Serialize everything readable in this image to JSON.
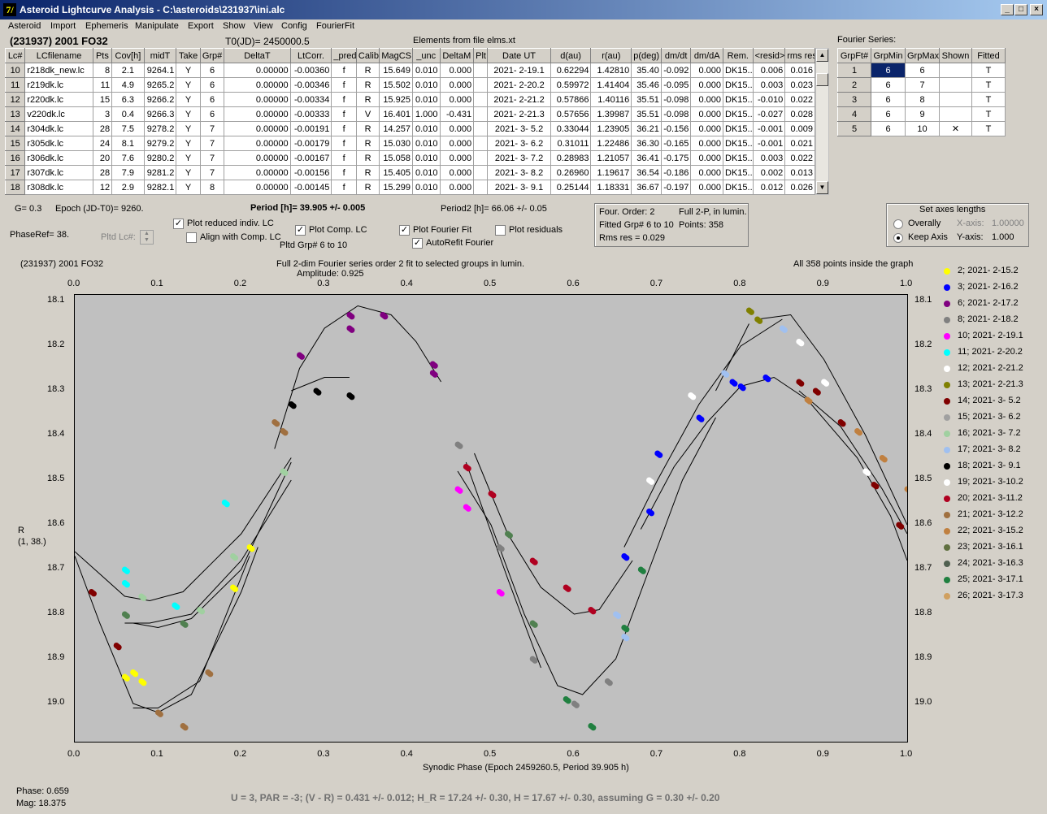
{
  "window": {
    "title": "Asteroid Lightcurve Analysis - C:\\asteroids\\231937\\ini.alc",
    "icon_label": "7/"
  },
  "menu": [
    "Asteroid",
    "Import",
    "Ephemeris",
    "Manipulate",
    "Export",
    "Show",
    "View",
    "Config",
    "FourierFit"
  ],
  "header": {
    "object": "(231937) 2001 FO32",
    "t0": "T0(JD)= 2450000.5",
    "elements": "Elements from file elms.xt",
    "fourier_series_label": "Fourier Series:"
  },
  "table": {
    "columns": [
      "Lc#",
      "LCfilename",
      "Pts",
      "Cov[h]",
      "midT",
      "Take",
      "Grp#",
      "DeltaT",
      "LtCorr.",
      "_pred.",
      "Calib.",
      "MagCS",
      "_unc",
      "DeltaM",
      "Plt",
      "Date UT",
      "d(au)",
      "r(au)",
      "p(deg)",
      "dm/dt",
      "dm/dA",
      "Rem.",
      "<resid>",
      "rms res"
    ],
    "rows": [
      [
        "10",
        "r218dk_new.lc",
        "8",
        "2.1",
        "9264.1",
        "Y",
        "6",
        "0.00000",
        "-0.00360",
        "f",
        "R",
        "15.649",
        "0.010",
        "0.000",
        "",
        "2021- 2-19.1",
        "0.62294",
        "1.42810",
        "35.40",
        "-0.092",
        "0.000",
        "DK15..",
        "0.006",
        "0.016"
      ],
      [
        "11",
        "r219dk.lc",
        "11",
        "4.9",
        "9265.2",
        "Y",
        "6",
        "0.00000",
        "-0.00346",
        "f",
        "R",
        "15.502",
        "0.010",
        "0.000",
        "",
        "2021- 2-20.2",
        "0.59972",
        "1.41404",
        "35.46",
        "-0.095",
        "0.000",
        "DK15..",
        "0.003",
        "0.023"
      ],
      [
        "12",
        "r220dk.lc",
        "15",
        "6.3",
        "9266.2",
        "Y",
        "6",
        "0.00000",
        "-0.00334",
        "f",
        "R",
        "15.925",
        "0.010",
        "0.000",
        "",
        "2021- 2-21.2",
        "0.57866",
        "1.40116",
        "35.51",
        "-0.098",
        "0.000",
        "DK15..",
        "-0.010",
        "0.022"
      ],
      [
        "13",
        "v220dk.lc",
        "3",
        "0.4",
        "9266.3",
        "Y",
        "6",
        "0.00000",
        "-0.00333",
        "f",
        "V",
        "16.401",
        "1.000",
        "-0.431",
        "",
        "2021- 2-21.3",
        "0.57656",
        "1.39987",
        "35.51",
        "-0.098",
        "0.000",
        "DK15..",
        "-0.027",
        "0.028"
      ],
      [
        "14",
        "r304dk.lc",
        "28",
        "7.5",
        "9278.2",
        "Y",
        "7",
        "0.00000",
        "-0.00191",
        "f",
        "R",
        "14.257",
        "0.010",
        "0.000",
        "",
        "2021- 3- 5.2",
        "0.33044",
        "1.23905",
        "36.21",
        "-0.156",
        "0.000",
        "DK15..",
        "-0.001",
        "0.009"
      ],
      [
        "15",
        "r305dk.lc",
        "24",
        "8.1",
        "9279.2",
        "Y",
        "7",
        "0.00000",
        "-0.00179",
        "f",
        "R",
        "15.030",
        "0.010",
        "0.000",
        "",
        "2021- 3- 6.2",
        "0.31011",
        "1.22486",
        "36.30",
        "-0.165",
        "0.000",
        "DK15..",
        "-0.001",
        "0.021"
      ],
      [
        "16",
        "r306dk.lc",
        "20",
        "7.6",
        "9280.2",
        "Y",
        "7",
        "0.00000",
        "-0.00167",
        "f",
        "R",
        "15.058",
        "0.010",
        "0.000",
        "",
        "2021- 3- 7.2",
        "0.28983",
        "1.21057",
        "36.41",
        "-0.175",
        "0.000",
        "DK15..",
        "0.003",
        "0.022"
      ],
      [
        "17",
        "r307dk.lc",
        "28",
        "7.9",
        "9281.2",
        "Y",
        "7",
        "0.00000",
        "-0.00156",
        "f",
        "R",
        "15.405",
        "0.010",
        "0.000",
        "",
        "2021- 3- 8.2",
        "0.26960",
        "1.19617",
        "36.54",
        "-0.186",
        "0.000",
        "DK15..",
        "0.002",
        "0.013"
      ],
      [
        "18",
        "r308dk.lc",
        "12",
        "2.9",
        "9282.1",
        "Y",
        "8",
        "0.00000",
        "-0.00145",
        "f",
        "R",
        "15.299",
        "0.010",
        "0.000",
        "",
        "2021- 3- 9.1",
        "0.25144",
        "1.18331",
        "36.67",
        "-0.197",
        "0.000",
        "DK15..",
        "0.012",
        "0.026"
      ]
    ]
  },
  "fourier_table": {
    "columns": [
      "GrpFt#",
      "GrpMin",
      "GrpMax",
      "Shown",
      "Fitted"
    ],
    "rows": [
      [
        "1",
        "6",
        "6",
        "",
        "T"
      ],
      [
        "2",
        "6",
        "7",
        "",
        "T"
      ],
      [
        "3",
        "6",
        "8",
        "",
        "T"
      ],
      [
        "4",
        "6",
        "9",
        "",
        "T"
      ],
      [
        "5",
        "6",
        "10",
        "✕",
        "T"
      ]
    ]
  },
  "controls": {
    "g": "G= 0.3",
    "epoch": "Epoch (JD-T0)= 9260.",
    "period": "Period [h]= 39.905 +/- 0.005",
    "period2": "Period2 [h]= 66.06 +/- 0.05",
    "phaseref": "PhaseRef= 38.",
    "pltd_lc": "Pltd Lc#:",
    "plot_reduced": "Plot reduced indiv. LC",
    "align_comp": "Align with Comp. LC",
    "plot_comp": "Plot Comp. LC",
    "pltd_grp": "Pltd Grp#  6  to  10",
    "plot_fourier": "Plot Fourier Fit",
    "autorefit": "AutoRefit Fourier",
    "plot_residuals": "Plot residuals",
    "plot_reduced_checked": true,
    "align_comp_checked": false,
    "plot_comp_checked": true,
    "plot_fourier_checked": true,
    "autorefit_checked": true,
    "plot_residuals_checked": false,
    "info_order": "Four. Order:  2",
    "info_full": "Full 2-P, in lumin.",
    "info_fitted": "Fitted Grp# 6 to 10",
    "info_points": "Points: 358",
    "info_rms": "Rms res     = 0.029",
    "axes_title": "Set axes lengths",
    "overally": "Overally",
    "keep_axis": "Keep Axis",
    "xaxis_label": "X-axis:",
    "xaxis_val": "1.00000",
    "yaxis_label": "Y-axis:",
    "yaxis_val": "1.000"
  },
  "plot": {
    "object": "(231937) 2001 FO32",
    "title": "Full 2-dim Fourier series order 2 fit to selected groups in lumin.",
    "amplitude": "Amplitude: 0.925",
    "points_note": "All 358 points inside the graph",
    "xlabel": "Synodic Phase (Epoch 2459260.5, Period 39.905 h)",
    "ylabel1": "R",
    "ylabel2": "(1, 38.)"
  },
  "chart_data": {
    "type": "scatter",
    "x_range": [
      0,
      1
    ],
    "y_range": [
      18.1,
      19.0
    ],
    "y_inverted": true,
    "x_ticks": [
      "0.0",
      "0.1",
      "0.2",
      "0.3",
      "0.4",
      "0.5",
      "0.6",
      "0.7",
      "0.8",
      "0.9",
      "1.0"
    ],
    "y_ticks": [
      "18.1",
      "18.2",
      "18.3",
      "18.4",
      "18.5",
      "18.6",
      "18.7",
      "18.8",
      "18.9",
      "19.0"
    ],
    "legend": [
      {
        "label": "2; 2021- 2-15.2",
        "color": "#ffff00"
      },
      {
        "label": "3; 2021- 2-16.2",
        "color": "#0000ff"
      },
      {
        "label": "6; 2021- 2-17.2",
        "color": "#800080"
      },
      {
        "label": "8; 2021- 2-18.2",
        "color": "#808080"
      },
      {
        "label": "10; 2021- 2-19.1",
        "color": "#ff00ff"
      },
      {
        "label": "11; 2021- 2-20.2",
        "color": "#00ffff"
      },
      {
        "label": "12; 2021- 2-21.2",
        "color": "#ffffff"
      },
      {
        "label": "13; 2021- 2-21.3",
        "color": "#808000"
      },
      {
        "label": "14; 2021- 3- 5.2",
        "color": "#800000"
      },
      {
        "label": "15; 2021- 3- 6.2",
        "color": "#a0a0a0"
      },
      {
        "label": "16; 2021- 3- 7.2",
        "color": "#a0d0a0"
      },
      {
        "label": "17; 2021- 3- 8.2",
        "color": "#a0c0f0"
      },
      {
        "label": "18; 2021- 3- 9.1",
        "color": "#000000"
      },
      {
        "label": "19; 2021- 3-10.2",
        "color": "#ffffff"
      },
      {
        "label": "20; 2021- 3-11.2",
        "color": "#b00020"
      },
      {
        "label": "21; 2021- 3-12.2",
        "color": "#a07040"
      },
      {
        "label": "22; 2021- 3-15.2",
        "color": "#c08040"
      },
      {
        "label": "23; 2021- 3-16.1",
        "color": "#607040"
      },
      {
        "label": "24; 2021- 3-16.3",
        "color": "#506050"
      },
      {
        "label": "25; 2021- 3-17.1",
        "color": "#208040"
      },
      {
        "label": "26; 2021- 3-17.3",
        "color": "#d0a060"
      }
    ],
    "points": [
      [
        0.06,
        18.94,
        "#ffff00"
      ],
      [
        0.07,
        18.93,
        "#ffff00"
      ],
      [
        0.08,
        18.95,
        "#ffff00"
      ],
      [
        0.19,
        18.74,
        "#ffff00"
      ],
      [
        0.21,
        18.65,
        "#ffff00"
      ],
      [
        0.79,
        18.28,
        "#0000ff"
      ],
      [
        0.8,
        18.29,
        "#0000ff"
      ],
      [
        0.83,
        18.27,
        "#0000ff"
      ],
      [
        0.69,
        18.57,
        "#0000ff"
      ],
      [
        0.7,
        18.44,
        "#0000ff"
      ],
      [
        0.75,
        18.36,
        "#0000ff"
      ],
      [
        0.66,
        18.67,
        "#0000ff"
      ],
      [
        0.27,
        18.22,
        "#800080"
      ],
      [
        0.33,
        18.13,
        "#800080"
      ],
      [
        0.33,
        18.16,
        "#800080"
      ],
      [
        0.37,
        18.13,
        "#800080"
      ],
      [
        0.43,
        18.24,
        "#800080"
      ],
      [
        0.43,
        18.26,
        "#800080"
      ],
      [
        0.46,
        18.42,
        "#808080"
      ],
      [
        0.51,
        18.65,
        "#808080"
      ],
      [
        0.55,
        18.9,
        "#808080"
      ],
      [
        0.6,
        19.0,
        "#808080"
      ],
      [
        0.64,
        18.95,
        "#808080"
      ],
      [
        0.46,
        18.52,
        "#ff00ff"
      ],
      [
        0.47,
        18.56,
        "#ff00ff"
      ],
      [
        0.51,
        18.75,
        "#ff00ff"
      ],
      [
        0.06,
        18.7,
        "#00ffff"
      ],
      [
        0.06,
        18.73,
        "#00ffff"
      ],
      [
        0.12,
        18.78,
        "#00ffff"
      ],
      [
        0.18,
        18.55,
        "#00ffff"
      ],
      [
        0.82,
        18.14,
        "#808000"
      ],
      [
        0.81,
        18.12,
        "#808000"
      ],
      [
        0.02,
        18.75,
        "#800000"
      ],
      [
        0.05,
        18.87,
        "#800000"
      ],
      [
        0.87,
        18.28,
        "#800000"
      ],
      [
        0.89,
        18.3,
        "#800000"
      ],
      [
        0.92,
        18.37,
        "#800000"
      ],
      [
        0.96,
        18.51,
        "#800000"
      ],
      [
        0.99,
        18.6,
        "#800000"
      ],
      [
        0.26,
        18.33,
        "#000000"
      ],
      [
        0.29,
        18.3,
        "#000000"
      ],
      [
        0.33,
        18.31,
        "#000000"
      ],
      [
        0.69,
        18.5,
        "#ffffff"
      ],
      [
        0.74,
        18.31,
        "#ffffff"
      ],
      [
        0.87,
        18.19,
        "#ffffff"
      ],
      [
        0.9,
        18.28,
        "#ffffff"
      ],
      [
        0.95,
        18.48,
        "#ffffff"
      ],
      [
        0.55,
        18.68,
        "#b00020"
      ],
      [
        0.59,
        18.74,
        "#b00020"
      ],
      [
        0.62,
        18.79,
        "#b00020"
      ],
      [
        0.47,
        18.47,
        "#b00020"
      ],
      [
        0.5,
        18.53,
        "#b00020"
      ],
      [
        0.1,
        19.02,
        "#a07040"
      ],
      [
        0.13,
        19.05,
        "#a07040"
      ],
      [
        0.16,
        18.93,
        "#a07040"
      ],
      [
        0.24,
        18.37,
        "#a07040"
      ],
      [
        0.25,
        18.39,
        "#a07040"
      ],
      [
        0.88,
        18.32,
        "#c08040"
      ],
      [
        0.94,
        18.39,
        "#c08040"
      ],
      [
        0.97,
        18.45,
        "#c08040"
      ],
      [
        1.0,
        18.52,
        "#c08040"
      ],
      [
        0.06,
        18.8,
        "#508050"
      ],
      [
        0.13,
        18.82,
        "#508050"
      ],
      [
        0.52,
        18.62,
        "#508050"
      ],
      [
        0.55,
        18.82,
        "#508050"
      ],
      [
        0.59,
        18.99,
        "#208040"
      ],
      [
        0.62,
        19.05,
        "#208040"
      ],
      [
        0.66,
        18.83,
        "#208040"
      ],
      [
        0.68,
        18.7,
        "#208040"
      ],
      [
        0.65,
        18.8,
        "#a0c0f0"
      ],
      [
        0.66,
        18.85,
        "#a0c0f0"
      ],
      [
        0.85,
        18.16,
        "#a0c0f0"
      ],
      [
        0.78,
        18.26,
        "#a0c0f0"
      ],
      [
        0.08,
        18.76,
        "#a0d0a0"
      ],
      [
        0.15,
        18.79,
        "#a0d0a0"
      ],
      [
        0.19,
        18.67,
        "#a0d0a0"
      ],
      [
        0.25,
        18.48,
        "#a0d0a0"
      ]
    ]
  },
  "status": {
    "phase": "Phase:  0.659",
    "mag": "Mag:   18.375",
    "result": "U = 3, PAR = -3; (V - R) = 0.431 +/- 0.012; H_R = 17.24 +/- 0.30, H = 17.67 +/- 0.30, assuming G = 0.30 +/- 0.20"
  }
}
